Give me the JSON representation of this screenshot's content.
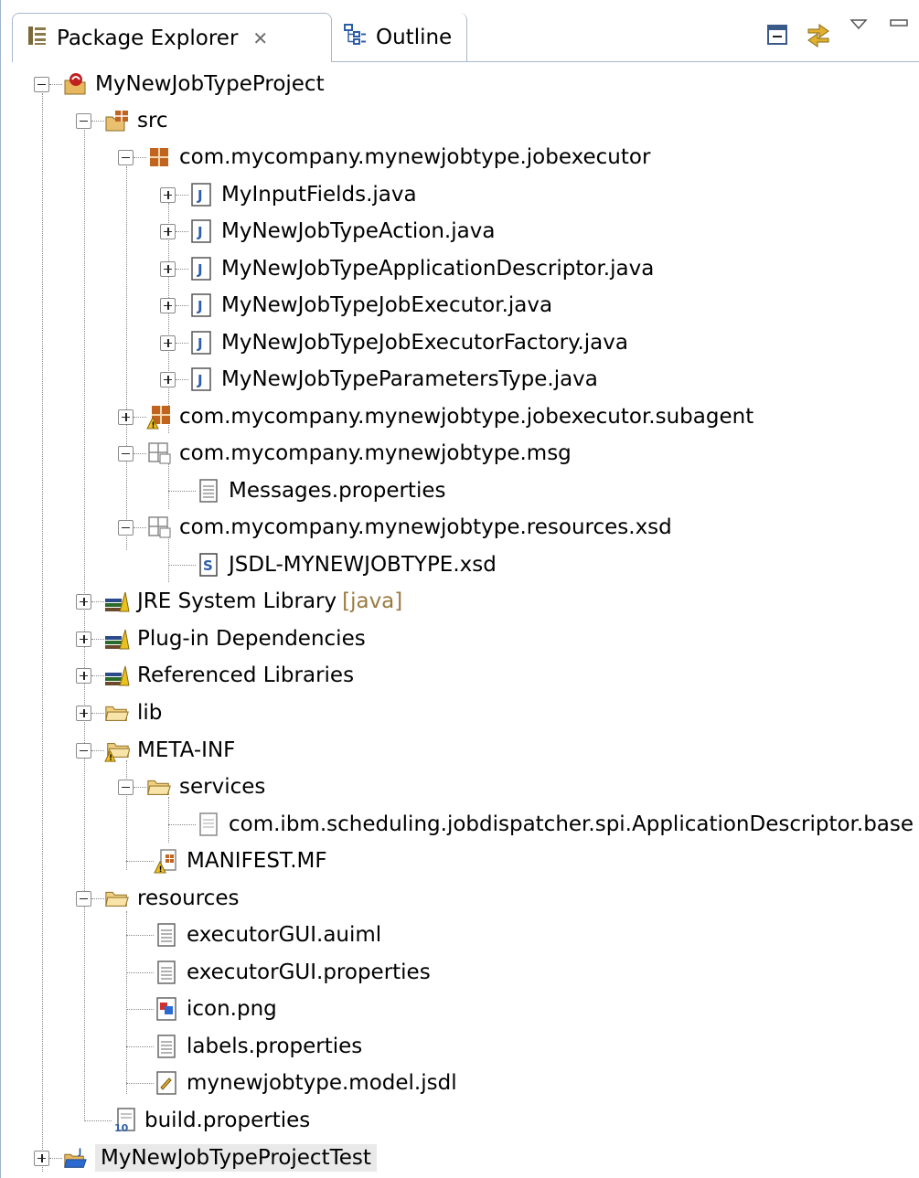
{
  "tabs": {
    "package_explorer": "Package Explorer",
    "outline": "Outline"
  },
  "tree": {
    "project": "MyNewJobTypeProject",
    "src": "src",
    "pkg_jobexecutor": "com.mycompany.mynewjobtype.jobexecutor",
    "files_jobexecutor": [
      "MyInputFields.java",
      "MyNewJobTypeAction.java",
      "MyNewJobTypeApplicationDescriptor.java",
      "MyNewJobTypeJobExecutor.java",
      "MyNewJobTypeJobExecutorFactory.java",
      "MyNewJobTypeParametersType.java"
    ],
    "pkg_subagent": "com.mycompany.mynewjobtype.jobexecutor.subagent",
    "pkg_msg": "com.mycompany.mynewjobtype.msg",
    "messages_props": "Messages.properties",
    "pkg_resources_xsd": "com.mycompany.mynewjobtype.resources.xsd",
    "xsd_file": "JSDL-MYNEWJOBTYPE.xsd",
    "jre_library": "JRE System Library",
    "jre_decoration": "[java]",
    "plugin_deps": "Plug-in Dependencies",
    "ref_libraries": "Referenced Libraries",
    "lib": "lib",
    "meta_inf": "META-INF",
    "services": "services",
    "service_file": "com.ibm.scheduling.jobdispatcher.spi.ApplicationDescriptor.base",
    "manifest": "MANIFEST.MF",
    "resources": "resources",
    "resource_files": [
      "executorGUI.auiml",
      "executorGUI.properties",
      "icon.png",
      "labels.properties",
      "mynewjobtype.model.jsdl"
    ],
    "build_props": "build.properties",
    "test_project": "MyNewJobTypeProjectTest"
  },
  "colors": {
    "selection_bg": "#e9e9e9",
    "tab_border": "#a9b8c9",
    "package_orange": "#c0641e",
    "java_blue": "#2d5ea8"
  }
}
